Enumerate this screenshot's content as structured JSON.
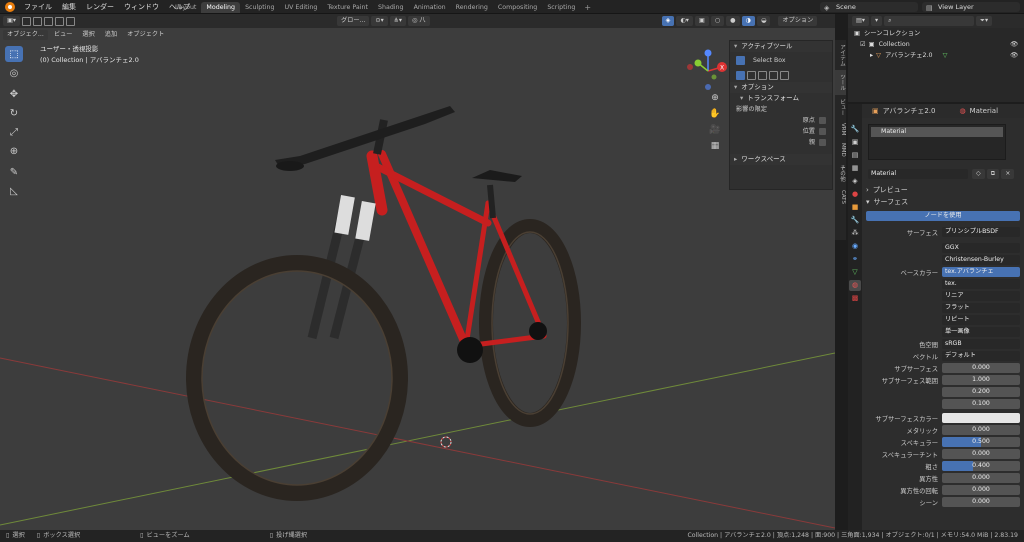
{
  "topbar": {
    "menus": [
      "ファイル",
      "編集",
      "レンダー",
      "ウィンドウ",
      "ヘルプ"
    ],
    "workspaces": [
      "Layout",
      "Modeling",
      "Sculpting",
      "UV Editing",
      "Texture Paint",
      "Shading",
      "Animation",
      "Rendering",
      "Compositing",
      "Scripting"
    ],
    "active_workspace": "Modeling",
    "scene": "Scene",
    "view_layer": "View Layer"
  },
  "viewport_header": {
    "mode": "オブジェク...",
    "menus": [
      "ビュー",
      "選択",
      "追加",
      "オブジェクト"
    ],
    "transform_orientation": "グロー...",
    "options": "オプション"
  },
  "viewport": {
    "view_name": "ユーザー・透視投影",
    "collection_info": "(0) Collection | アバランチェ2.0"
  },
  "npanel": {
    "active_tool_header": "アクティブツール",
    "select_box": "Select Box",
    "options_header": "オプション",
    "transform_header": "トランスフォーム",
    "affect_only": "影響の限定",
    "origin": "原点",
    "location": "位置",
    "parent": "親",
    "workspace_header": "ワークスペース",
    "tabs": [
      "アイテム",
      "ツール",
      "ビュー",
      "VRM",
      "MMD",
      "その他",
      "CATS"
    ]
  },
  "outliner": {
    "scene_collection": "シーンコレクション",
    "collection": "Collection",
    "object": "アバランチェ2.0"
  },
  "properties": {
    "object_name": "アバランチェ2.0",
    "material_tab": "Material",
    "slot_name": "Material",
    "material_field": "Material",
    "preview": "プレビュー",
    "surface_header": "サーフェス",
    "use_nodes": "ノードを使用",
    "rows": [
      {
        "label": "サーフェス",
        "value": "プリンシプルBSDF"
      },
      {
        "label": "",
        "value": "GGX"
      },
      {
        "label": "",
        "value": "Christensen-Burley"
      },
      {
        "label": "ベースカラー",
        "value": "tex.アバランチェ"
      },
      {
        "label": "",
        "value": "tex."
      },
      {
        "label": "",
        "value": "リニア"
      },
      {
        "label": "",
        "value": "フラット"
      },
      {
        "label": "",
        "value": "リピート"
      },
      {
        "label": "",
        "value": "単一画像"
      },
      {
        "label": "色空間",
        "value": "sRGB"
      },
      {
        "label": "ベクトル",
        "value": "デフォルト"
      },
      {
        "label": "サブサーフェス",
        "value": "0.000"
      },
      {
        "label": "サブサーフェス範囲",
        "value": "1.000"
      },
      {
        "label": "",
        "value": "0.200"
      },
      {
        "label": "",
        "value": "0.100"
      },
      {
        "label": "サブサーフェスカラー",
        "value": ""
      },
      {
        "label": "メタリック",
        "value": "0.000"
      },
      {
        "label": "スペキュラー",
        "value": "0.500"
      },
      {
        "label": "スペキュラーチント",
        "value": "0.000"
      },
      {
        "label": "粗さ",
        "value": "0.400"
      },
      {
        "label": "異方性",
        "value": "0.000"
      },
      {
        "label": "異方性の回転",
        "value": "0.000"
      },
      {
        "label": "シーン",
        "value": "0.000"
      }
    ]
  },
  "statusbar": {
    "select": "選択",
    "box_select": "ボックス選択",
    "zoom_view": "ビューをズーム",
    "lasso": "投げ縄選択",
    "stats": "Collection | アバランチェ2.0 | 頂点:1,248 | 面:900 | 三角面:1,934 | オブジェクト:0/1 | メモリ:54.0 MiB | 2.83.19"
  },
  "colors": {
    "accent": "#4772b3",
    "bike_frame": "#d42222",
    "tire": "#2a2520"
  }
}
